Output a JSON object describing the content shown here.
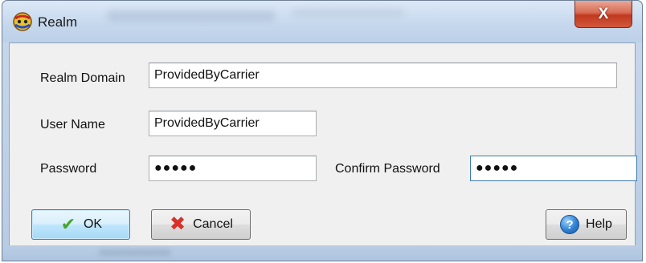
{
  "window": {
    "title": "Realm",
    "close_label": "X"
  },
  "form": {
    "realm_domain_label": "Realm Domain",
    "realm_domain_value": "ProvidedByCarrier",
    "user_name_label": "User Name",
    "user_name_value": "ProvidedByCarrier",
    "password_label": "Password",
    "password_value": "●●●●●",
    "confirm_password_label": "Confirm Password",
    "confirm_password_value": "●●●●●"
  },
  "buttons": {
    "ok_label": "OK",
    "cancel_label": "Cancel",
    "help_label": "Help",
    "help_icon_glyph": "?"
  },
  "icons": {
    "app": "realm-app-icon",
    "ok": "checkmark-icon",
    "cancel": "red-x-icon",
    "help": "help-question-icon"
  }
}
